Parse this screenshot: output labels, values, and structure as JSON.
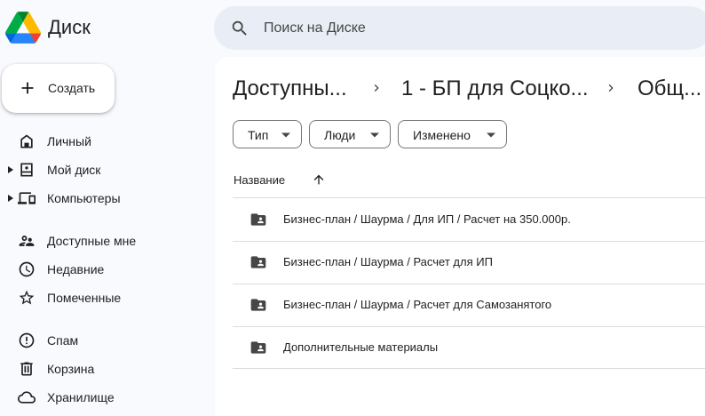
{
  "header": {
    "app_name": "Диск",
    "search_placeholder": "Поиск на Диске"
  },
  "sidebar": {
    "create_label": "Создать",
    "items": [
      {
        "label": "Личный"
      },
      {
        "label": "Мой диск"
      },
      {
        "label": "Компьютеры"
      },
      {
        "label": "Доступные мне"
      },
      {
        "label": "Недавние"
      },
      {
        "label": "Помеченные"
      },
      {
        "label": "Спам"
      },
      {
        "label": "Корзина"
      },
      {
        "label": "Хранилище"
      }
    ]
  },
  "breadcrumb": [
    "Доступны...",
    "1 - БП для Соцко...",
    "Общ..."
  ],
  "filters": [
    "Тип",
    "Люди",
    "Изменено"
  ],
  "list": {
    "column_name": "Название",
    "rows": [
      {
        "name": "Бизнес-план / Шаурма / Для ИП / Расчет на 350.000р."
      },
      {
        "name": "Бизнес-план / Шаурма / Расчет для ИП"
      },
      {
        "name": "Бизнес-план / Шаурма / Расчет для Самозанятого"
      },
      {
        "name": "Дополнительные материалы"
      }
    ]
  },
  "colors": {
    "background": "#f8fafd",
    "search_bg": "#e9eef6",
    "icon": "#444746"
  }
}
